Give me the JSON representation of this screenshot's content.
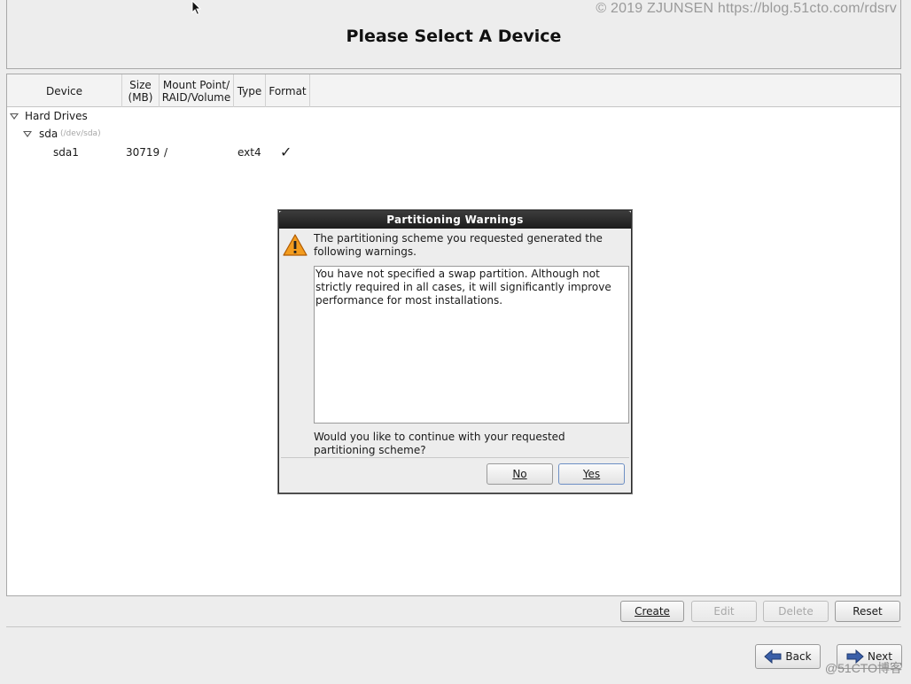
{
  "watermark_top": "© 2019 ZJUNSEN https://blog.51cto.com/rdsrv",
  "watermark_bottom": "@51CTO博客",
  "header": {
    "title": "Please Select A Device"
  },
  "columns": {
    "device": "Device",
    "size": "Size (MB)",
    "mount": "Mount Point/ RAID/Volume",
    "type": "Type",
    "format": "Format"
  },
  "tree": {
    "group": "Hard Drives",
    "disk": {
      "name": "sda",
      "path": "(/dev/sda)"
    },
    "partition": {
      "name": "sda1",
      "size": "30719",
      "mount": "/",
      "type": "ext4",
      "format": "✓"
    }
  },
  "actions": {
    "create": "Create",
    "edit": "Edit",
    "delete": "Delete",
    "reset": "Reset"
  },
  "nav": {
    "back": "Back",
    "next": "Next"
  },
  "dialog": {
    "title": "Partitioning Warnings",
    "message": "The partitioning scheme you requested generated the following warnings.",
    "details": "You have not specified a swap partition.  Although not strictly required in all cases, it will significantly improve performance for most installations.",
    "question": "Would you like to continue with your requested partitioning scheme?",
    "no": "No",
    "yes": "Yes"
  },
  "icons": {
    "warning": "warning-triangle-icon",
    "back": "arrow-left-icon",
    "next": "arrow-right-icon",
    "cursor": "mouse-pointer-icon"
  },
  "colors": {
    "warning": "#f39c1e",
    "arrow": "#3a5fa8",
    "dialog_title_bg": "#2a2a2a"
  }
}
